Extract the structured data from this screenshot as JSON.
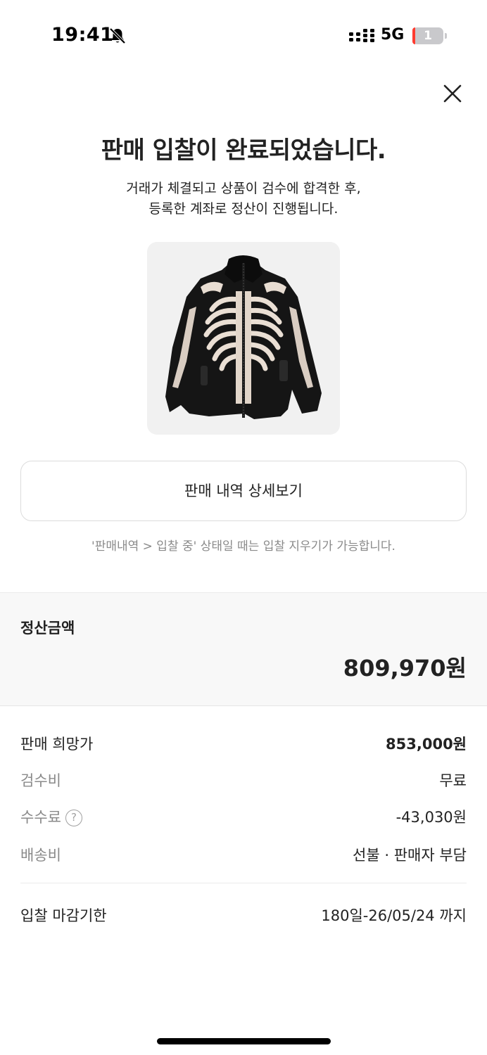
{
  "status_bar": {
    "time": "19:41",
    "network": "5G",
    "battery": "1"
  },
  "icons": {
    "bell_off": "bell-slash-icon",
    "signal": "cellular-signal-icon",
    "close": "close-icon",
    "help": "question-circle-icon"
  },
  "header": {
    "title": "판매 입찰이 완료되었습니다.",
    "subtitle_line1": "거래가 체결되고 상품이 검수에 합격한 후,",
    "subtitle_line2": "등록한 계좌로 정산이 진행됩니다."
  },
  "actions": {
    "detail_label": "판매 내역 상세보기",
    "hint": "'판매내역 > 입찰 중' 상태일 때는 입찰 지우기가 가능합니다."
  },
  "settlement": {
    "label": "정산금액",
    "amount": "809,970원"
  },
  "details": {
    "rows": [
      {
        "label": "판매 희망가",
        "value": "853,000원"
      },
      {
        "label": "검수비",
        "value": "무료"
      },
      {
        "label": "수수료",
        "value": "-43,030원",
        "help": "?"
      },
      {
        "label": "배송비",
        "value": "선불 · 판매자 부담"
      }
    ],
    "deadline": {
      "label": "입찰 마감기한",
      "value": "180일-26/05/24 까지"
    }
  }
}
